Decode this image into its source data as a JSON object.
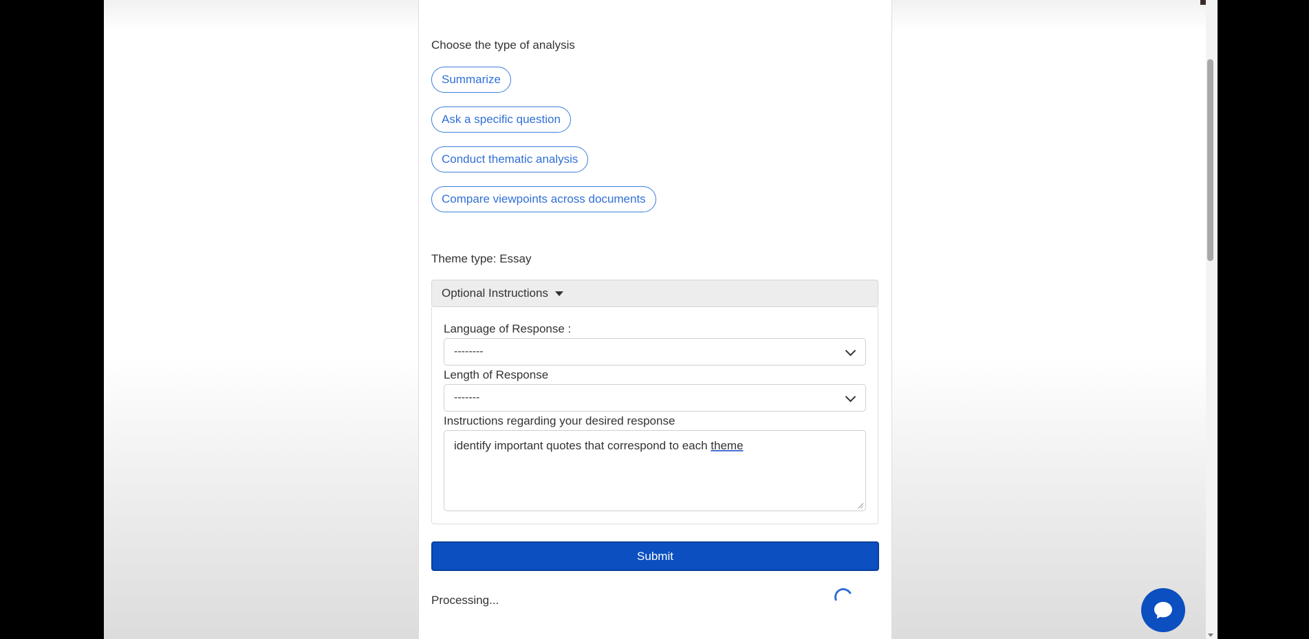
{
  "analysis": {
    "heading": "Choose the type of analysis",
    "options": [
      {
        "label": "Summarize"
      },
      {
        "label": "Ask a specific question"
      },
      {
        "label": "Conduct thematic analysis"
      },
      {
        "label": "Compare viewpoints across documents"
      }
    ]
  },
  "theme": {
    "text": "Theme type: Essay"
  },
  "optional_instructions": {
    "title": "Optional Instructions",
    "language": {
      "label": "Language of Response :",
      "selected": "--------"
    },
    "length": {
      "label": "Length of Response",
      "selected": "-------"
    },
    "instructions": {
      "label": "Instructions regarding your desired response",
      "value_main": "identify important quotes that correspond to each ",
      "value_flagged": "theme"
    }
  },
  "submit": {
    "label": "Submit"
  },
  "status": {
    "text": "Processing..."
  },
  "colors": {
    "accent": "#2f6fd6",
    "primary_button": "#0b4fc0"
  },
  "icons": {
    "caret": "caret-down-icon",
    "select_chevron": "chevron-down-icon",
    "spinner": "loading-spinner-icon",
    "chat": "chat-bubble-icon"
  }
}
